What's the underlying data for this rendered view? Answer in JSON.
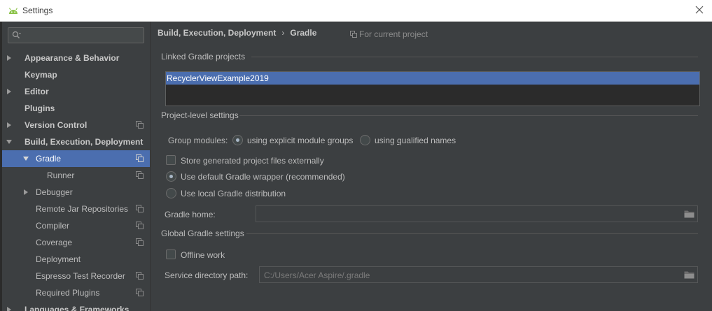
{
  "window": {
    "title": "Settings"
  },
  "search": {
    "placeholder": "",
    "value": ""
  },
  "sidebar": {
    "items": [
      {
        "label": "Appearance & Behavior",
        "bold": true,
        "arrow": "right",
        "indent": 0,
        "copy": false,
        "selected": false
      },
      {
        "label": "Keymap",
        "bold": true,
        "arrow": "none",
        "indent": 0,
        "copy": false,
        "selected": false
      },
      {
        "label": "Editor",
        "bold": true,
        "arrow": "right",
        "indent": 0,
        "copy": false,
        "selected": false
      },
      {
        "label": "Plugins",
        "bold": true,
        "arrow": "none",
        "indent": 0,
        "copy": false,
        "selected": false
      },
      {
        "label": "Version Control",
        "bold": true,
        "arrow": "right",
        "indent": 0,
        "copy": true,
        "selected": false
      },
      {
        "label": "Build, Execution, Deployment",
        "bold": true,
        "arrow": "down",
        "indent": 0,
        "copy": false,
        "selected": false
      },
      {
        "label": "Gradle",
        "bold": false,
        "arrow": "down",
        "indent": 1,
        "copy": true,
        "selected": true
      },
      {
        "label": "Runner",
        "bold": false,
        "arrow": "none",
        "indent": 2,
        "copy": true,
        "selected": false
      },
      {
        "label": "Debugger",
        "bold": false,
        "arrow": "right",
        "indent": 1,
        "copy": false,
        "selected": false
      },
      {
        "label": "Remote Jar Repositories",
        "bold": false,
        "arrow": "none",
        "indent": 1,
        "copy": true,
        "selected": false
      },
      {
        "label": "Compiler",
        "bold": false,
        "arrow": "none",
        "indent": 1,
        "copy": true,
        "selected": false
      },
      {
        "label": "Coverage",
        "bold": false,
        "arrow": "none",
        "indent": 1,
        "copy": true,
        "selected": false
      },
      {
        "label": "Deployment",
        "bold": false,
        "arrow": "none",
        "indent": 1,
        "copy": false,
        "selected": false
      },
      {
        "label": "Espresso Test Recorder",
        "bold": false,
        "arrow": "none",
        "indent": 1,
        "copy": true,
        "selected": false
      },
      {
        "label": "Required Plugins",
        "bold": false,
        "arrow": "none",
        "indent": 1,
        "copy": true,
        "selected": false
      },
      {
        "label": "Languages & Frameworks",
        "bold": true,
        "arrow": "right",
        "indent": 0,
        "copy": false,
        "selected": false
      }
    ]
  },
  "breadcrumb": {
    "parent": "Build, Execution, Deployment",
    "separator": "›",
    "current": "Gradle"
  },
  "scope": {
    "label": "For current project",
    "icon": "copy-icon"
  },
  "linked": {
    "title": "Linked Gradle projects",
    "projects": [
      "RecyclerViewExample2019"
    ]
  },
  "project_level": {
    "title": "Project-level settings",
    "group_modules_label": "Group modules:",
    "option_explicit": "using explicit module groups",
    "option_qualified_prefix": "using ",
    "option_qualified_underlined": "q",
    "option_qualified_suffix": "ualified names",
    "selected_group_option": "explicit",
    "store_external_label": "Store generated project files externally",
    "store_external_checked": false,
    "wrapper_default_label": "Use default Gradle wrapper (recommended)",
    "wrapper_local_label": "Use local Gradle distribution",
    "selected_wrapper": "default",
    "gradle_home_label": "Gradle home:",
    "gradle_home_value": ""
  },
  "global": {
    "title": "Global Gradle settings",
    "offline_label": "Offline work",
    "offline_checked": false,
    "service_dir_label": "Service directory path:",
    "service_dir_value": "C:/Users/Acer Aspire/.gradle"
  },
  "colors": {
    "background": "#3c3f41",
    "selection": "#4b6eaf",
    "text": "#bbbbbb",
    "list_bg": "#2b2b2b"
  }
}
